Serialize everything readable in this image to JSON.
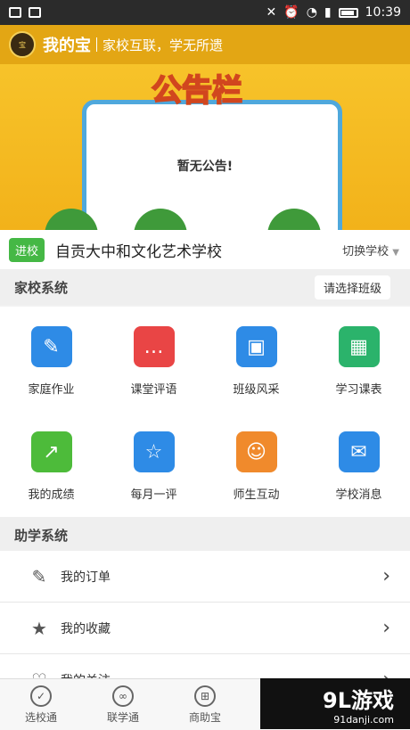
{
  "status": {
    "time": "10:39"
  },
  "header": {
    "logo_text": "宝",
    "app_name": "我的宝",
    "slogan": "家校互联，学无所遗"
  },
  "banner": {
    "title": "公告栏",
    "notice": "暂无公告!"
  },
  "school": {
    "badge": "进校",
    "name": "自贡大中和文化艺术学校",
    "switch": "切换学校"
  },
  "home_school": {
    "title": "家校系统",
    "select_class": "请选择班级",
    "items": [
      {
        "label": "家庭作业",
        "icon": "edit-icon",
        "color": "#2e8be6"
      },
      {
        "label": "课堂评语",
        "icon": "comment-icon",
        "color": "#e94545"
      },
      {
        "label": "班级风采",
        "icon": "photo-icon",
        "color": "#2e8be6"
      },
      {
        "label": "学习课表",
        "icon": "calendar-icon",
        "color": "#2bb36b"
      },
      {
        "label": "我的成绩",
        "icon": "chart-icon",
        "color": "#4dbb3a"
      },
      {
        "label": "每月一评",
        "icon": "star-icon",
        "color": "#2e8be6"
      },
      {
        "label": "师生互动",
        "icon": "chat-icon",
        "color": "#f08a2c"
      },
      {
        "label": "学校消息",
        "icon": "mail-icon",
        "color": "#2e8be6"
      }
    ]
  },
  "study": {
    "title": "助学系统",
    "items": [
      {
        "label": "我的订单",
        "icon": "order-icon"
      },
      {
        "label": "我的收藏",
        "icon": "star-icon"
      },
      {
        "label": "我的关注",
        "icon": "heart-icon"
      }
    ]
  },
  "tabs": [
    {
      "label": "选校通",
      "icon": "check-icon"
    },
    {
      "label": "联学通",
      "icon": "link-icon"
    },
    {
      "label": "商助宝",
      "icon": "cart-icon"
    }
  ],
  "watermark": {
    "big": "9L游戏",
    "small": "91danji.com"
  }
}
